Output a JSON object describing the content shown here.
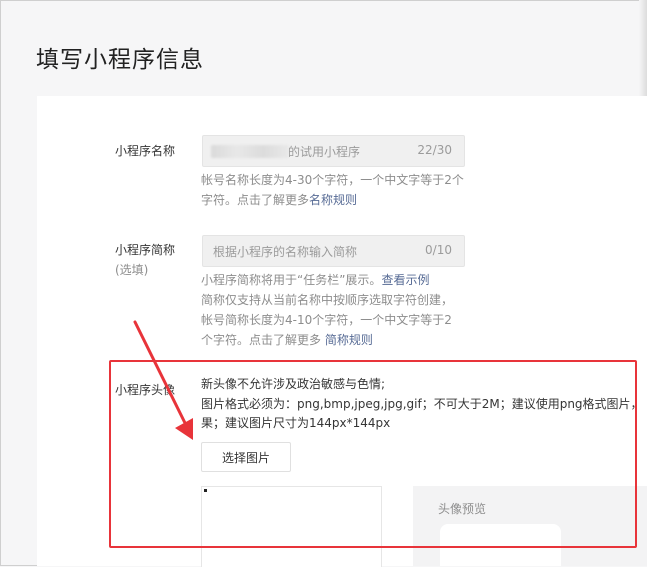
{
  "page": {
    "title": "填写小程序信息"
  },
  "name_field": {
    "label": "小程序名称",
    "value": "的试用小程序",
    "count": "22/30",
    "hint_text": "帐号名称长度为4-30个字符，一个中文字等于2个字符。点击了解更多",
    "hint_link": "名称规则"
  },
  "short_name_field": {
    "label": "小程序简称",
    "label_sub": "(选填)",
    "placeholder": "根据小程序的名称输入简称",
    "count": "0/10",
    "hint_line1": "小程序简称将用于“任务栏”展示。",
    "hint_link1": "查看示例",
    "hint_line2": "简称仅支持从当前名称中按顺序选取字符创建，",
    "hint_line3": "帐号简称长度为4-10个字符，一个中文字等于2",
    "hint_line4": "个字符。点击了解更多 ",
    "hint_link2": "简称规则"
  },
  "avatar_field": {
    "label": "小程序头像",
    "req_line1": "新头像不允许涉及政治敏感与色情;",
    "req_line2": "图片格式必须为：png,bmp,jpeg,jpg,gif；不可大于2M；建议使用png格式图片，",
    "req_line3": "果；建议图片尺寸为144px*144px",
    "select_button": "选择图片",
    "preview_title": "头像预览"
  },
  "colors": {
    "annotation": "#e8343a",
    "link": "#576b95"
  }
}
